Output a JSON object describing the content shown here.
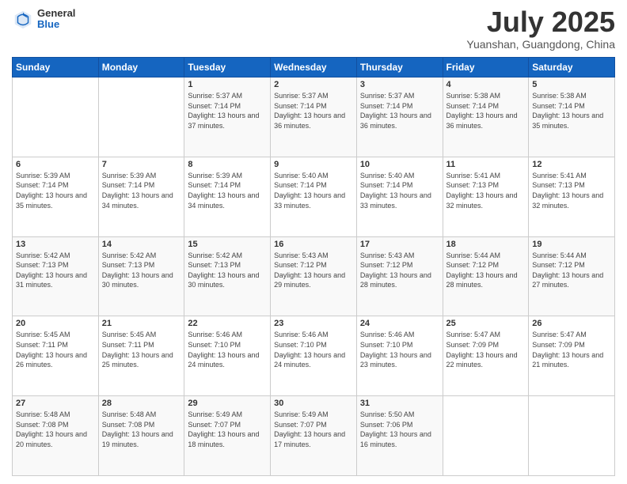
{
  "logo": {
    "general": "General",
    "blue": "Blue"
  },
  "header": {
    "month": "July 2025",
    "location": "Yuanshan, Guangdong, China"
  },
  "days_of_week": [
    "Sunday",
    "Monday",
    "Tuesday",
    "Wednesday",
    "Thursday",
    "Friday",
    "Saturday"
  ],
  "weeks": [
    [
      {
        "day": "",
        "info": ""
      },
      {
        "day": "",
        "info": ""
      },
      {
        "day": "1",
        "info": "Sunrise: 5:37 AM\nSunset: 7:14 PM\nDaylight: 13 hours and 37 minutes."
      },
      {
        "day": "2",
        "info": "Sunrise: 5:37 AM\nSunset: 7:14 PM\nDaylight: 13 hours and 36 minutes."
      },
      {
        "day": "3",
        "info": "Sunrise: 5:37 AM\nSunset: 7:14 PM\nDaylight: 13 hours and 36 minutes."
      },
      {
        "day": "4",
        "info": "Sunrise: 5:38 AM\nSunset: 7:14 PM\nDaylight: 13 hours and 36 minutes."
      },
      {
        "day": "5",
        "info": "Sunrise: 5:38 AM\nSunset: 7:14 PM\nDaylight: 13 hours and 35 minutes."
      }
    ],
    [
      {
        "day": "6",
        "info": "Sunrise: 5:39 AM\nSunset: 7:14 PM\nDaylight: 13 hours and 35 minutes."
      },
      {
        "day": "7",
        "info": "Sunrise: 5:39 AM\nSunset: 7:14 PM\nDaylight: 13 hours and 34 minutes."
      },
      {
        "day": "8",
        "info": "Sunrise: 5:39 AM\nSunset: 7:14 PM\nDaylight: 13 hours and 34 minutes."
      },
      {
        "day": "9",
        "info": "Sunrise: 5:40 AM\nSunset: 7:14 PM\nDaylight: 13 hours and 33 minutes."
      },
      {
        "day": "10",
        "info": "Sunrise: 5:40 AM\nSunset: 7:14 PM\nDaylight: 13 hours and 33 minutes."
      },
      {
        "day": "11",
        "info": "Sunrise: 5:41 AM\nSunset: 7:13 PM\nDaylight: 13 hours and 32 minutes."
      },
      {
        "day": "12",
        "info": "Sunrise: 5:41 AM\nSunset: 7:13 PM\nDaylight: 13 hours and 32 minutes."
      }
    ],
    [
      {
        "day": "13",
        "info": "Sunrise: 5:42 AM\nSunset: 7:13 PM\nDaylight: 13 hours and 31 minutes."
      },
      {
        "day": "14",
        "info": "Sunrise: 5:42 AM\nSunset: 7:13 PM\nDaylight: 13 hours and 30 minutes."
      },
      {
        "day": "15",
        "info": "Sunrise: 5:42 AM\nSunset: 7:13 PM\nDaylight: 13 hours and 30 minutes."
      },
      {
        "day": "16",
        "info": "Sunrise: 5:43 AM\nSunset: 7:12 PM\nDaylight: 13 hours and 29 minutes."
      },
      {
        "day": "17",
        "info": "Sunrise: 5:43 AM\nSunset: 7:12 PM\nDaylight: 13 hours and 28 minutes."
      },
      {
        "day": "18",
        "info": "Sunrise: 5:44 AM\nSunset: 7:12 PM\nDaylight: 13 hours and 28 minutes."
      },
      {
        "day": "19",
        "info": "Sunrise: 5:44 AM\nSunset: 7:12 PM\nDaylight: 13 hours and 27 minutes."
      }
    ],
    [
      {
        "day": "20",
        "info": "Sunrise: 5:45 AM\nSunset: 7:11 PM\nDaylight: 13 hours and 26 minutes."
      },
      {
        "day": "21",
        "info": "Sunrise: 5:45 AM\nSunset: 7:11 PM\nDaylight: 13 hours and 25 minutes."
      },
      {
        "day": "22",
        "info": "Sunrise: 5:46 AM\nSunset: 7:10 PM\nDaylight: 13 hours and 24 minutes."
      },
      {
        "day": "23",
        "info": "Sunrise: 5:46 AM\nSunset: 7:10 PM\nDaylight: 13 hours and 24 minutes."
      },
      {
        "day": "24",
        "info": "Sunrise: 5:46 AM\nSunset: 7:10 PM\nDaylight: 13 hours and 23 minutes."
      },
      {
        "day": "25",
        "info": "Sunrise: 5:47 AM\nSunset: 7:09 PM\nDaylight: 13 hours and 22 minutes."
      },
      {
        "day": "26",
        "info": "Sunrise: 5:47 AM\nSunset: 7:09 PM\nDaylight: 13 hours and 21 minutes."
      }
    ],
    [
      {
        "day": "27",
        "info": "Sunrise: 5:48 AM\nSunset: 7:08 PM\nDaylight: 13 hours and 20 minutes."
      },
      {
        "day": "28",
        "info": "Sunrise: 5:48 AM\nSunset: 7:08 PM\nDaylight: 13 hours and 19 minutes."
      },
      {
        "day": "29",
        "info": "Sunrise: 5:49 AM\nSunset: 7:07 PM\nDaylight: 13 hours and 18 minutes."
      },
      {
        "day": "30",
        "info": "Sunrise: 5:49 AM\nSunset: 7:07 PM\nDaylight: 13 hours and 17 minutes."
      },
      {
        "day": "31",
        "info": "Sunrise: 5:50 AM\nSunset: 7:06 PM\nDaylight: 13 hours and 16 minutes."
      },
      {
        "day": "",
        "info": ""
      },
      {
        "day": "",
        "info": ""
      }
    ]
  ]
}
